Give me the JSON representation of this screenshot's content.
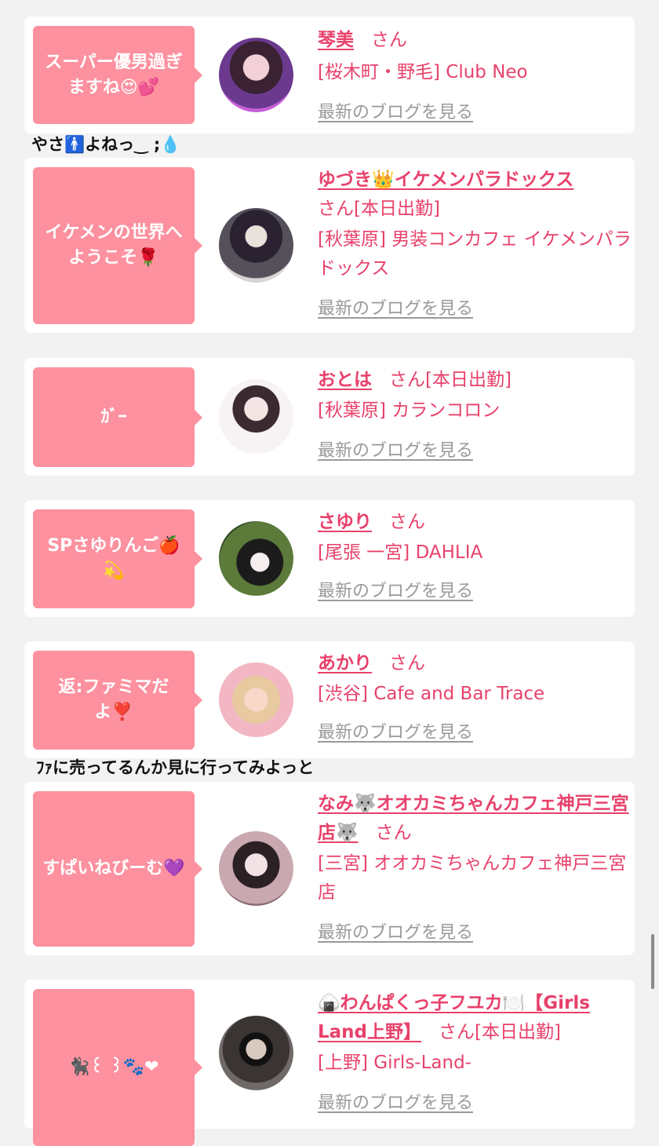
{
  "cards": [
    {
      "message": "スーパー優男過ぎますね😍💕",
      "name": "琴美",
      "suffix": "さん",
      "shop": "[桜木町・野毛] Club Neo",
      "blog_link": "最新のブログを見る"
    },
    {
      "message": "イケメンの世界へようこそ🌹",
      "name": "ゆづき👑イケメンパラドックス",
      "suffix": "さん[本日出勤]",
      "shop": "[秋葉原] 男装コンカフェ イケメンパラドックス",
      "blog_link": "最新のブログを見る"
    },
    {
      "message": "ｶﾞｰ",
      "name": "おとは",
      "suffix": "さん[本日出勤]",
      "shop": "[秋葉原] カランコロン",
      "blog_link": "最新のブログを見る"
    },
    {
      "message": "SPさゆりんご🍎💫",
      "name": "さゆり",
      "suffix": "さん",
      "shop": "[尾張 一宮] DAHLIA",
      "blog_link": "最新のブログを見る"
    },
    {
      "message": "返:ファミマだよ❣️",
      "name": "あかり",
      "suffix": "さん",
      "shop": "[渋谷] Cafe and Bar Trace",
      "blog_link": "最新のブログを見る"
    },
    {
      "message": "すぱいねびーむ💜",
      "name": "なみ🐺オオカミちゃんカフェ神戸三宮店🐺",
      "suffix": "さん",
      "shop": "[三宮] オオカミちゃんカフェ神戸三宮店",
      "blog_link": "最新のブログを見る"
    },
    {
      "message": "🐈‍⬛꒰ ꒱🐾❤",
      "name": "🍙わんぱくっ子フユカ🍽️【Girls Land上野】",
      "suffix": "さん[本日出勤]",
      "shop": "[上野] Girls-Land-",
      "blog_link": "最新のブログを見る"
    }
  ],
  "comments": {
    "after_card_1": "やさ🚹よねっ‿ ;💧",
    "after_card_5": "ﾌｧに売ってるんか見に行ってみよっと"
  }
}
